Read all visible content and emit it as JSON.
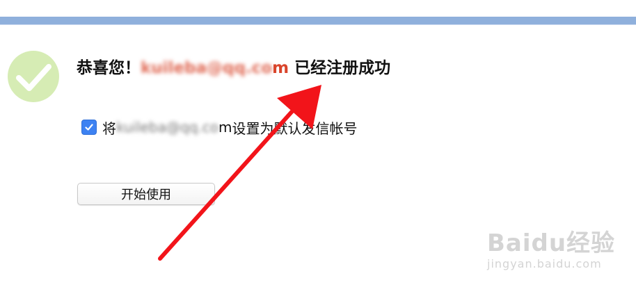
{
  "header_band": {
    "color": "#8fb0dc"
  },
  "success": {
    "icon": "checkmark-circle-icon",
    "icon_color": "#d6ecb4",
    "prefix": "恭喜您！",
    "email_blurred": "kuileba@qq.co",
    "email_tail": "m",
    "suffix": " 已经注册成功",
    "email_color": "#d9442b"
  },
  "default_account": {
    "checked": true,
    "prefix": "将 ",
    "email_blurred": "kuileba@qq.co",
    "email_tail": "m",
    "suffix": " 设置为默认发信帐号"
  },
  "start_button": {
    "label": "开始使用"
  },
  "watermark": {
    "brand": "Baidu经验",
    "url": "jingyan.baidu.com"
  },
  "annotation": {
    "arrow_color": "#f2141a"
  }
}
